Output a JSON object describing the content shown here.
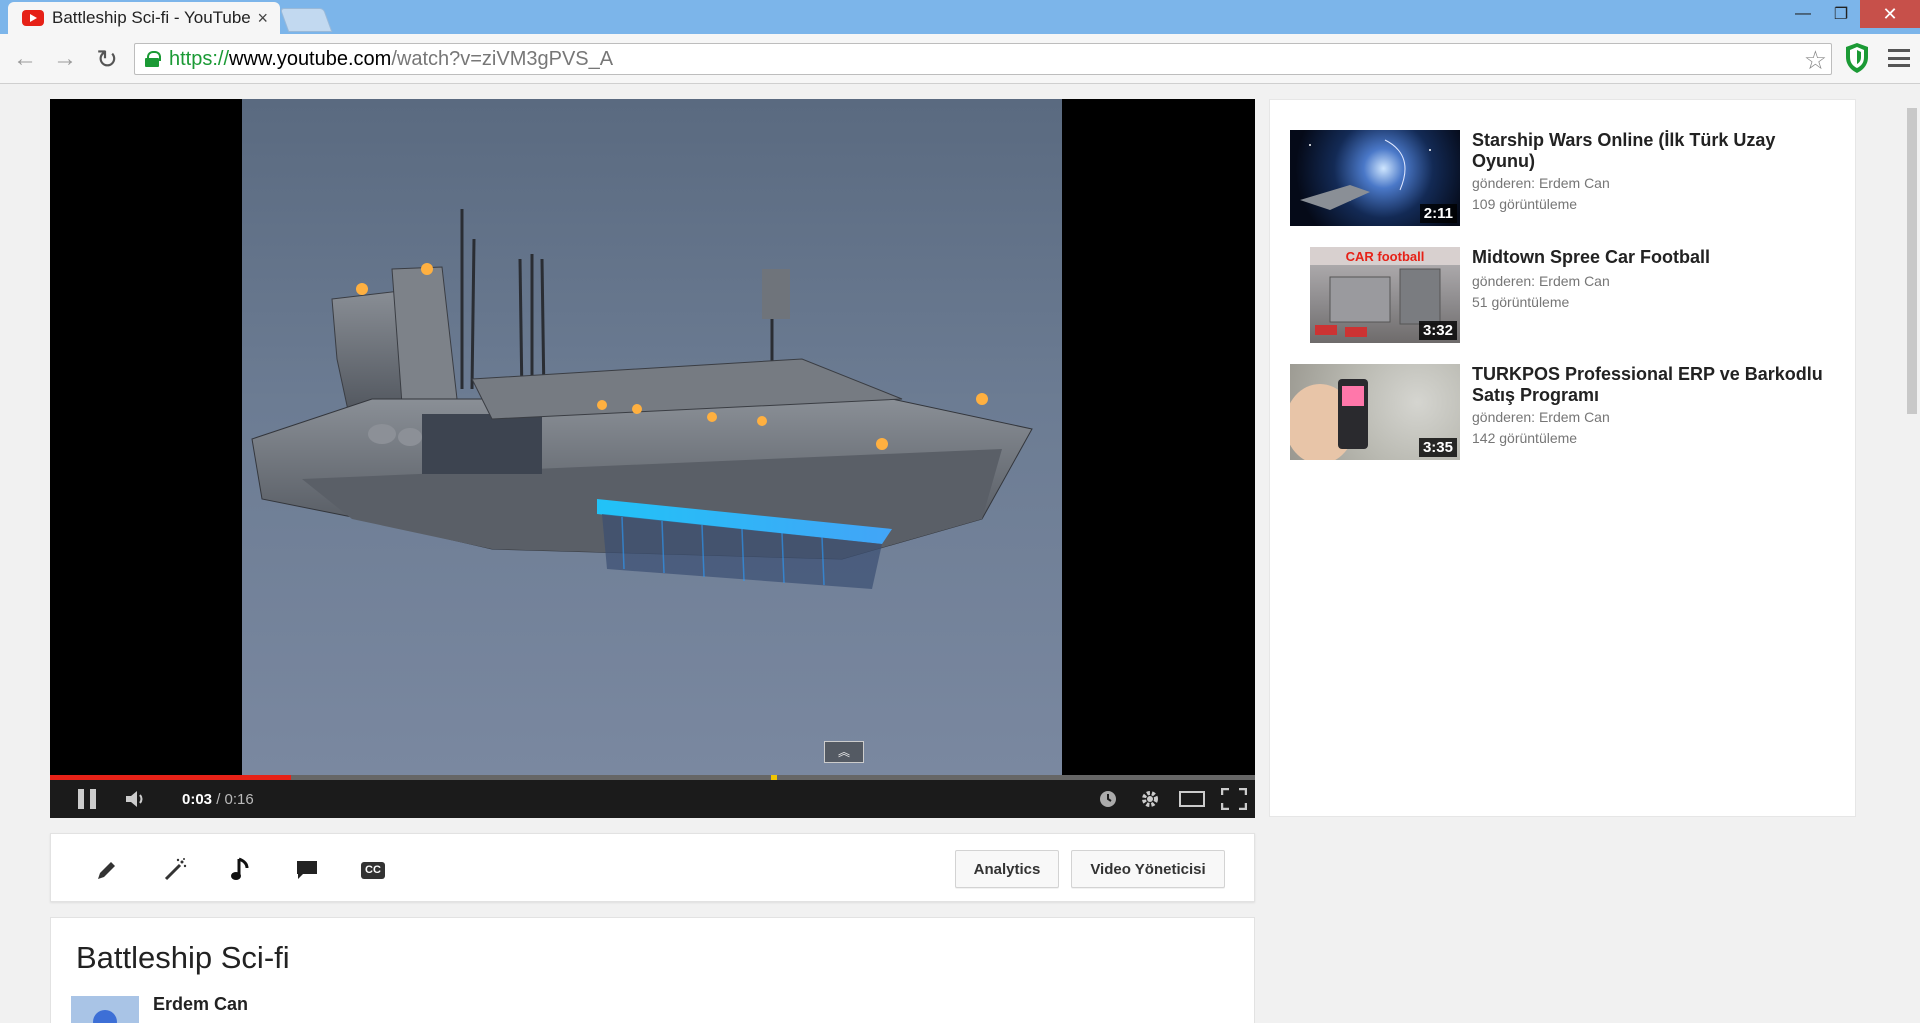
{
  "browser": {
    "tab_title": "Battleship Sci-fi - YouTube",
    "tab_close": "×",
    "url_scheme": "https://",
    "url_host": "www.youtube.com",
    "url_path": "/watch?v=ziVM3gPVS_A",
    "win_min": "—",
    "win_restore": "❐",
    "win_close": "✕",
    "back": "←",
    "forward": "→",
    "reload": "↻",
    "star": "☆"
  },
  "player": {
    "current_time": "0:03",
    "separator": " / ",
    "duration": "0:16",
    "played_fraction": 0.2,
    "marker_fraction": 0.598,
    "collapse": "︽"
  },
  "creator_bar": {
    "analytics_label": "Analytics",
    "video_manager_label": "Video Yöneticisi"
  },
  "video": {
    "title": "Battleship Sci-fi",
    "channel": "Erdem Can"
  },
  "related": [
    {
      "title": "Starship Wars Online (İlk Türk Uzay Oyunu)",
      "uploader": "gönderen: Erdem Can",
      "views": "109 görüntüleme",
      "duration": "2:11"
    },
    {
      "title": "Midtown Spree Car Football",
      "uploader": "gönderen: Erdem Can",
      "views": "51 görüntüleme",
      "duration": "3:32",
      "thumb_text": "CAR football"
    },
    {
      "title": "TURKPOS Professional ERP ve Barkodlu Satış Programı",
      "uploader": "gönderen: Erdem Can",
      "views": "142 görüntüleme",
      "duration": "3:35"
    }
  ],
  "colors": {
    "youtube_red": "#e62117",
    "progress_marker": "#f0c400",
    "secure_green": "#1b9a35"
  }
}
